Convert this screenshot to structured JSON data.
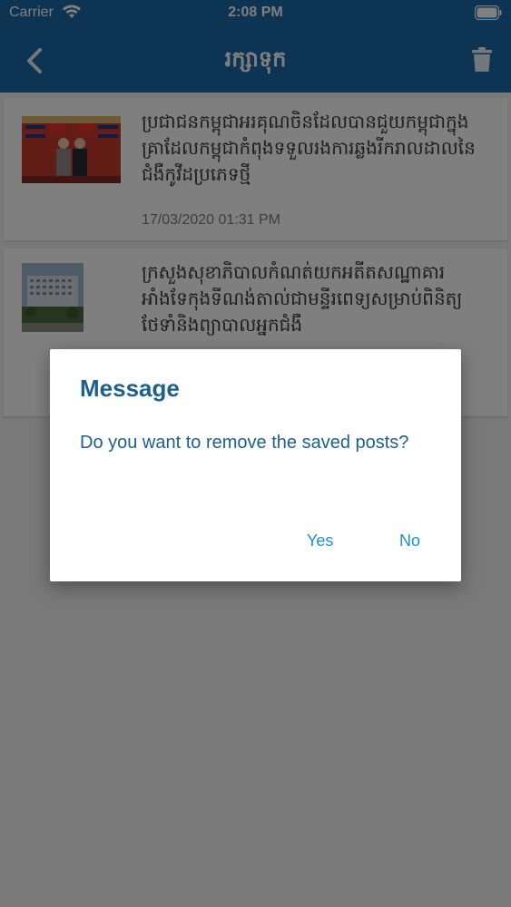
{
  "status_bar": {
    "carrier": "Carrier",
    "time": "2:08 PM",
    "icons": [
      "wifi-icon",
      "battery-icon"
    ]
  },
  "nav": {
    "title": "រក្សាទុក",
    "back_icon": "chevron-left-icon",
    "delete_icon": "trash-icon"
  },
  "posts": [
    {
      "title": "ប្រជាជនកម្ពុជាអរគុណចិនដែលបានជួយកម្ពុជាក្នុងគ្រាដែលកម្ពុជាកំពុងទទួលរងការឆ្លងរីករាលដាលនៃជំងឺកូវីដប្រភេទថ្មី",
      "date": "17/03/2020 01:31 PM"
    },
    {
      "title": "ក្រសួងសុខាភិបាលកំណត់យកអតីតសណ្ឋាគារអាំងទែកុងទីណង់តាល់ជាមន្ទីរពេទ្យសម្រាប់ពិនិត្យ ថែទាំនិងព្យាបាលអ្នកជំងឺ",
      "date": ""
    }
  ],
  "dialog": {
    "title": "Message",
    "message": "Do you want to remove the saved posts?",
    "yes_label": "Yes",
    "no_label": "No"
  },
  "colors": {
    "primary": "#1a69a6",
    "dialog_text": "#1f5f8c",
    "dialog_button": "#1d8fd0"
  }
}
